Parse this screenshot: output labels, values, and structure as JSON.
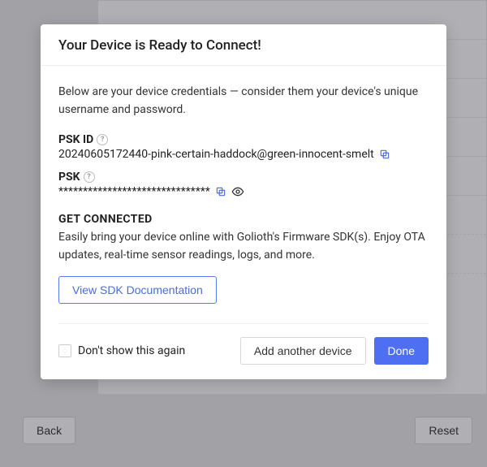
{
  "bg": {
    "back": "Back",
    "reset": "Reset"
  },
  "modal": {
    "title": "Your Device is Ready to Connect!",
    "intro": "Below are your device credentials — consider them your device's unique username and password.",
    "pskIdLabel": "PSK ID",
    "pskIdValue": "20240605172440-pink-certain-haddock@green-innocent-smelt",
    "pskLabel": "PSK",
    "pskValue": "*******************************",
    "getConnectedLabel": "GET CONNECTED",
    "getConnectedText": "Easily bring your device online with Golioth's Firmware SDK(s). Enjoy OTA updates, real-time sensor readings, logs, and more.",
    "sdkButton": "View SDK Documentation",
    "dontShowLabel": "Don't show this again",
    "addAnother": "Add another device",
    "done": "Done"
  }
}
